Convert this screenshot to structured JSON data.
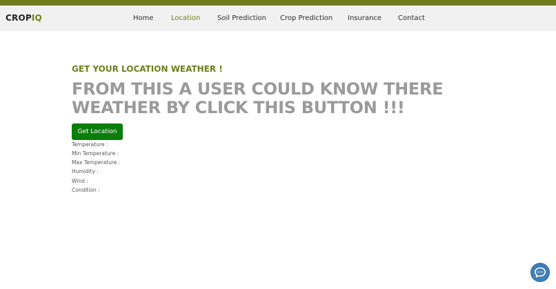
{
  "brand": {
    "logo_prefix": "CROP",
    "logo_accent": "IQ"
  },
  "colors": {
    "accent": "#6f7d1c",
    "button": "#0b7d0b",
    "headline": "#9a9a9a",
    "chat": "#3f7fb6"
  },
  "nav": {
    "items": [
      {
        "label": "Home"
      },
      {
        "label": "Location"
      },
      {
        "label": "Soil Prediction"
      },
      {
        "label": "Crop Prediction"
      },
      {
        "label": "Insurance"
      },
      {
        "label": "Contact"
      }
    ],
    "active": "Location"
  },
  "hero": {
    "kicker": "GET YOUR LOCATION WEATHER !",
    "headline": "FROM THIS A USER COULD KNOW THERE WEATHER BY CLICK THIS BUTTON !!!",
    "button_label": "Get Location"
  },
  "weather": {
    "lines": [
      {
        "label": "Temperature :"
      },
      {
        "label": "Min Temperature :"
      },
      {
        "label": "Max Temperature :"
      },
      {
        "label": "Humidity :"
      },
      {
        "label": "Wind :"
      },
      {
        "label": "Condition :"
      }
    ]
  },
  "chat": {
    "icon": "chat-bubble-icon"
  }
}
